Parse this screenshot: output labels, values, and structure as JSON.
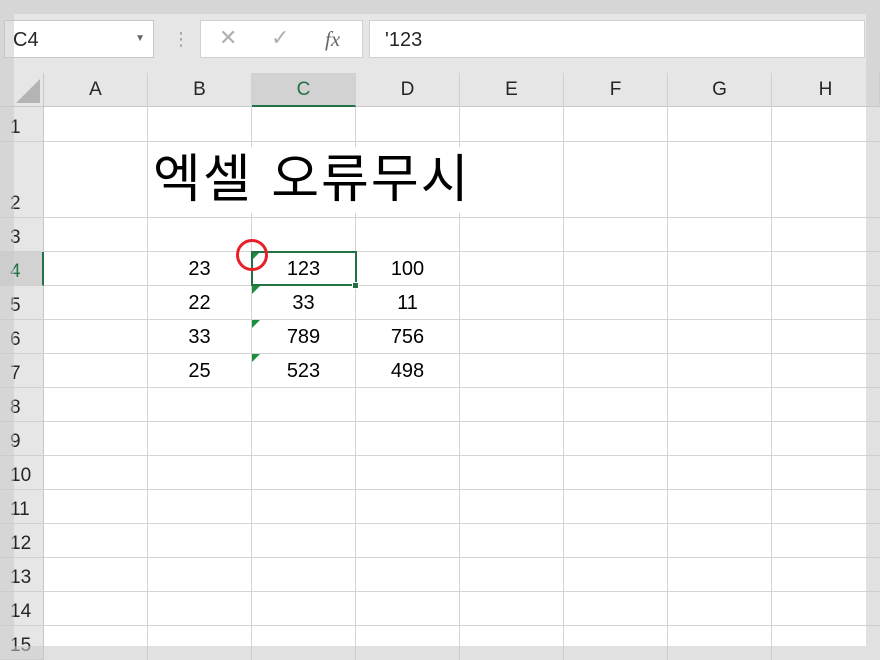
{
  "formula_bar": {
    "name_box": "C4",
    "formula": "'123",
    "cancel_glyph": "✕",
    "enter_glyph": "✓",
    "fx_label": "fx"
  },
  "columns": [
    "A",
    "B",
    "C",
    "D",
    "E",
    "F",
    "G",
    "H"
  ],
  "selected_column": "C",
  "rows": [
    "1",
    "2",
    "3",
    "4",
    "5",
    "6",
    "7",
    "8",
    "9",
    "10",
    "11",
    "12",
    "13",
    "14",
    "15"
  ],
  "selected_row": "4",
  "title_cell": {
    "ref": "B2",
    "text": "엑셀 오류무시"
  },
  "table": [
    {
      "row": "4",
      "B": "23",
      "C": "123",
      "D": "100"
    },
    {
      "row": "5",
      "B": "22",
      "C": "33",
      "D": "11"
    },
    {
      "row": "6",
      "B": "33",
      "C": "789",
      "D": "756"
    },
    {
      "row": "7",
      "B": "25",
      "C": "523",
      "D": "498"
    }
  ],
  "selected_cell": "C4",
  "error_indicator_color": "#1e8e3e",
  "accent_color": "#217346",
  "annotation_color": "#e8202a"
}
